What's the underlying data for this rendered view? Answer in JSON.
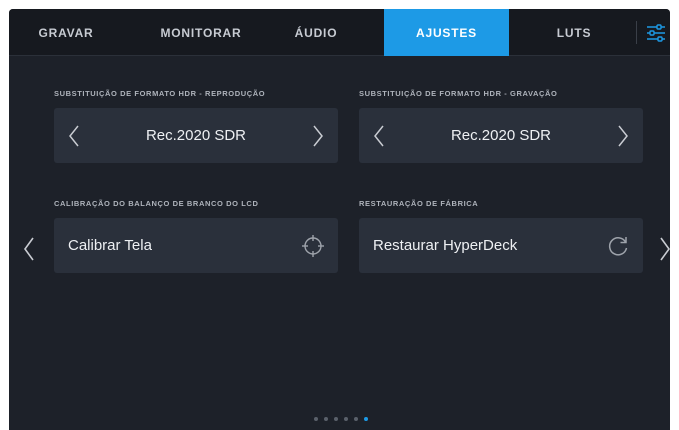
{
  "tabs": [
    {
      "label": "GRAVAR",
      "active": false
    },
    {
      "label": "MONITORAR",
      "active": false
    },
    {
      "label": "ÁUDIO",
      "active": false
    },
    {
      "label": "AJUSTES",
      "active": true
    },
    {
      "label": "LUTS",
      "active": false
    }
  ],
  "settings": {
    "hdr_playback": {
      "label": "SUBSTITUIÇÃO DE FORMATO HDR - REPRODUÇÃO",
      "value": "Rec.2020 SDR"
    },
    "hdr_record": {
      "label": "SUBSTITUIÇÃO DE FORMATO HDR - GRAVAÇÃO",
      "value": "Rec.2020 SDR"
    },
    "lcd_white_balance": {
      "label": "CALIBRAÇÃO DO BALANÇO DE BRANCO DO LCD",
      "action": "Calibrar Tela"
    },
    "factory_reset": {
      "label": "RESTAURAÇÃO DE FÁBRICA",
      "action": "Restaurar HyperDeck"
    }
  },
  "pagination": {
    "total": 6,
    "current": 6
  },
  "colors": {
    "accent": "#1d9ae6",
    "background": "#1d2129",
    "card": "#2a303b"
  },
  "icons": {
    "menu": "sliders-icon",
    "prev": "chevron-left-icon",
    "next": "chevron-right-icon",
    "calibrate": "crosshair-icon",
    "reset": "refresh-icon"
  }
}
